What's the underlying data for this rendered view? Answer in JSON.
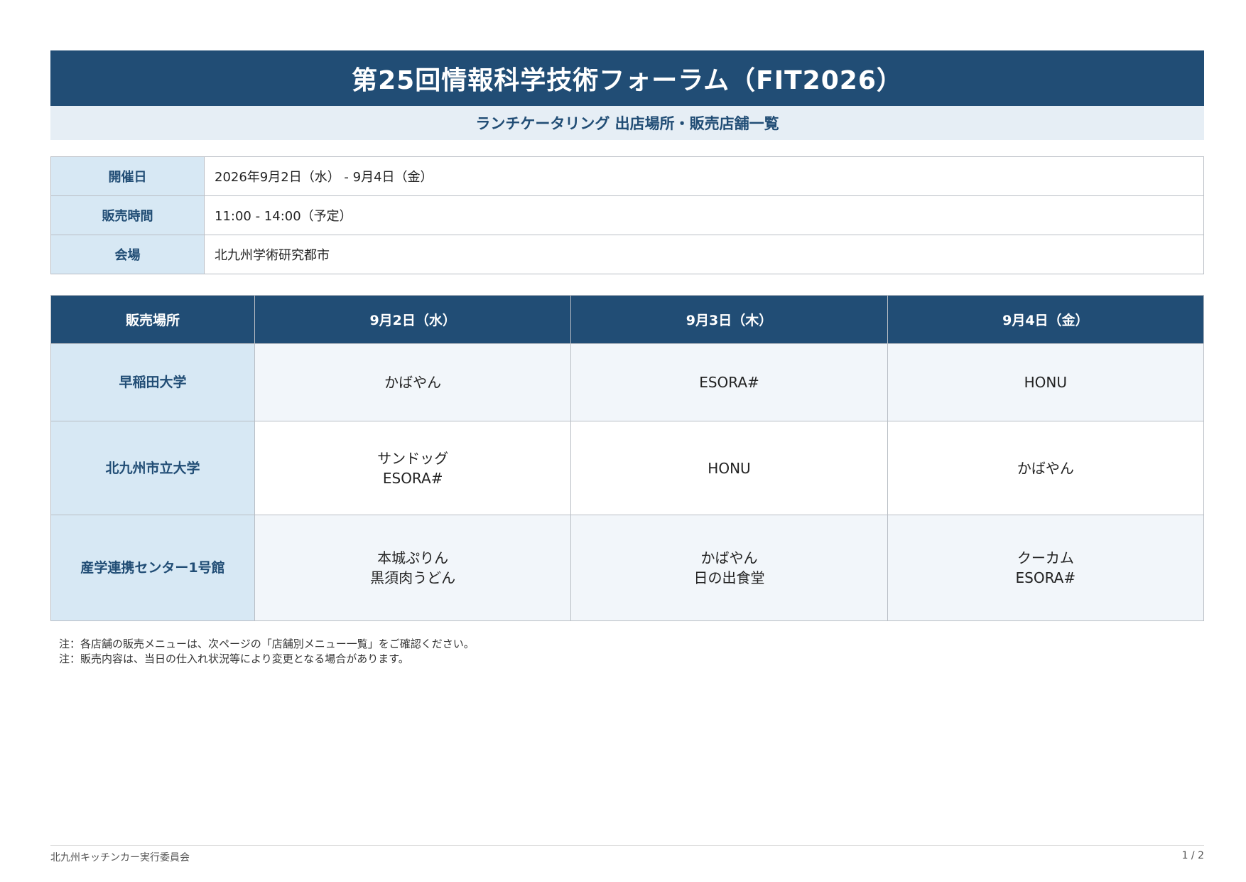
{
  "header": {
    "title": "第25回情報科学技術フォーラム（FIT2026）",
    "subtitle": "ランチケータリング 出店場所・販売店舗一覧"
  },
  "info": [
    {
      "label": "開催日",
      "value": "2026年9月2日（水） - 9月4日（金）"
    },
    {
      "label": "販売時間",
      "value": "11:00 - 14:00（予定）"
    },
    {
      "label": "会場",
      "value": "北九州学術研究都市"
    }
  ],
  "schedule": {
    "headers": [
      "販売場所",
      "9月2日（水）",
      "9月3日（木）",
      "9月4日（金）"
    ],
    "rows": [
      {
        "location": "早稲田大学",
        "days": [
          [
            "かばやん"
          ],
          [
            "ESORA#"
          ],
          [
            "HONU"
          ]
        ]
      },
      {
        "location": "北九州市立大学",
        "days": [
          [
            "サンドッグ",
            "ESORA#"
          ],
          [
            "HONU"
          ],
          [
            "かばやん"
          ]
        ]
      },
      {
        "location": "産学連携センター1号館",
        "days": [
          [
            "本城ぷりん",
            "黒須肉うどん"
          ],
          [
            "かばやん",
            "日の出食堂"
          ],
          [
            "クーカム",
            "ESORA#"
          ]
        ]
      }
    ]
  },
  "notes": [
    "注：各店舗の販売メニューは、次ページの「店舗別メニュー一覧」をご確認ください。",
    "注：販売内容は、当日の仕入れ状況等により変更となる場合があります。"
  ],
  "footer": {
    "organizer": "北九州キッチンカー実行委員会",
    "page": "1 / 2"
  }
}
